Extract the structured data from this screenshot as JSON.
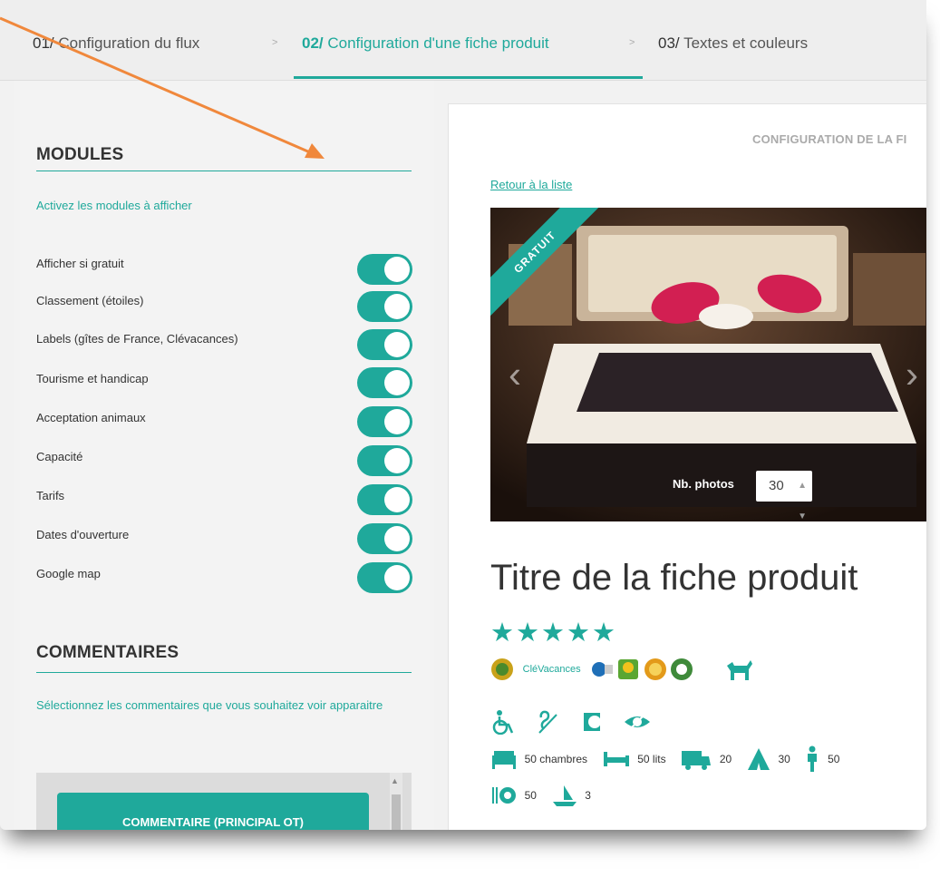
{
  "nav": {
    "steps": [
      {
        "num": "01/",
        "label": "Configuration du flux"
      },
      {
        "num": "02/",
        "label": "Configuration d'une fiche produit"
      },
      {
        "num": "03/",
        "label": "Textes et couleurs"
      }
    ],
    "separator": ">"
  },
  "modules": {
    "title": "MODULES",
    "hint": "Activez les modules à afficher",
    "items": [
      {
        "label": "Afficher si gratuit",
        "enabled": true
      },
      {
        "label": "Classement (étoiles)",
        "enabled": true
      },
      {
        "label": "Labels (gîtes de France, Clévacances)",
        "enabled": true
      },
      {
        "label": "Tourisme et handicap",
        "enabled": true
      },
      {
        "label": "Acceptation animaux",
        "enabled": true
      },
      {
        "label": "Capacité",
        "enabled": true
      },
      {
        "label": "Tarifs",
        "enabled": true
      },
      {
        "label": "Dates d'ouverture",
        "enabled": true
      },
      {
        "label": "Google map",
        "enabled": true
      }
    ]
  },
  "comments": {
    "title": "COMMENTAIRES",
    "hint": "Sélectionnez les commentaires que vous souhaitez voir apparaitre",
    "button_label": "COMMENTAIRE (PRINCIPAL OT)"
  },
  "preview": {
    "config_title": "CONFIGURATION DE LA FI",
    "back_link": "Retour à la liste",
    "ribbon": "GRATUIT",
    "nb_photos_label": "Nb. photos",
    "nb_photos_value": "30",
    "product_title": "Titre de la fiche produit",
    "stars": "★★★★★",
    "star_rating": 5,
    "label_logo_text": "CléVacances",
    "capacity": {
      "rooms": "50 chambres",
      "beds": "50 lits",
      "campers": "20",
      "tents": "30",
      "persons": "50",
      "meals": "50",
      "boats": "3"
    }
  },
  "colors": {
    "accent": "#1fa99b",
    "annotation_arrow": "#f0883c"
  }
}
